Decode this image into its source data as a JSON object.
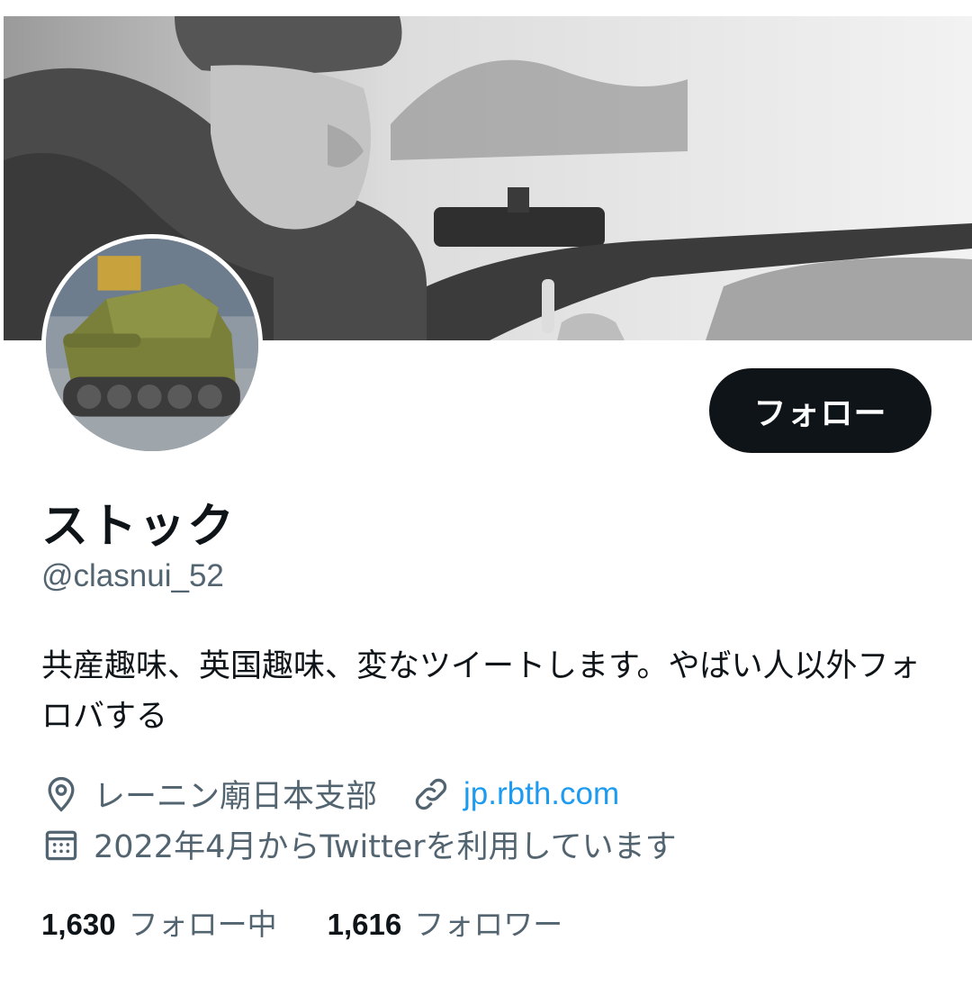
{
  "profile": {
    "display_name": "ストック",
    "handle": "@clasnui_52",
    "bio": "共産趣味、英国趣味、変なツイートします。やばい人以外フォロバする",
    "location": "レーニン廟日本支部",
    "website": "jp.rbth.com",
    "joined": "2022年4月からTwitterを利用しています",
    "follow_label": "フォロー"
  },
  "stats": {
    "following_count": "1,630",
    "following_label": "フォロー中",
    "followers_count": "1,616",
    "followers_label": "フォロワー"
  },
  "icons": {
    "location": "location-pin-icon",
    "website": "link-icon",
    "joined": "calendar-icon"
  },
  "colors": {
    "follow_button_bg": "#0f1419",
    "link": "#1d9bf0",
    "secondary_text": "#536471"
  }
}
